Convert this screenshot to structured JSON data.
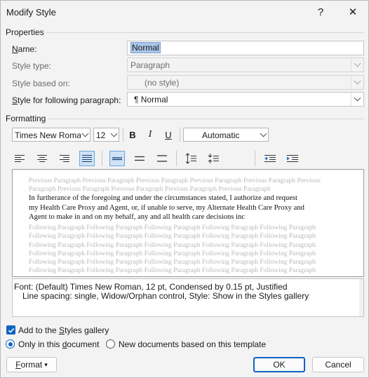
{
  "window": {
    "title": "Modify Style",
    "help_icon": "?",
    "close_icon": "✕"
  },
  "properties": {
    "section_title": "Properties",
    "name": {
      "label_ul": "N",
      "label_rest": "ame:",
      "value": "Normal"
    },
    "style_type": {
      "label": "Style type:",
      "value": "Paragraph"
    },
    "style_based_on": {
      "label": "Style based on:",
      "value": "(no style)"
    },
    "following": {
      "label_ul": "S",
      "label_rest": "tyle for following paragraph:",
      "value": "¶  Normal"
    }
  },
  "formatting": {
    "section_title": "Formatting",
    "font": "Times New Roman",
    "size": "12",
    "bold": "B",
    "italic": "I",
    "underline": "U",
    "color": "Automatic"
  },
  "preview": {
    "prev_lines": [
      "Previous Paragraph Previous Paragraph Previous Paragraph Previous Paragraph Previous Paragraph Previous",
      "Paragraph Previous Paragraph Previous Paragraph Previous Paragraph Previous Paragraph"
    ],
    "main_lines": [
      "In furtherance of the foregoing and under the circumstances stated, I authorize and request",
      "my Health Care Proxy and Agent, or, if unable to serve, my Alternate Health Care Proxy and",
      "Agent to make in and on my behalf, any and all health care decisions inc"
    ],
    "follow_lines": [
      "Following Paragraph Following Paragraph Following Paragraph Following Paragraph Following Paragraph",
      "Following Paragraph Following Paragraph Following Paragraph Following Paragraph Following Paragraph",
      "Following Paragraph Following Paragraph Following Paragraph Following Paragraph Following Paragraph",
      "Following Paragraph Following Paragraph Following Paragraph Following Paragraph Following Paragraph",
      "Following Paragraph Following Paragraph Following Paragraph Following Paragraph Following Paragraph",
      "Following Paragraph Following Paragraph Following Paragraph Following Paragraph Following Paragraph"
    ]
  },
  "description": {
    "line1": "Font: (Default) Times New Roman, 12 pt, Condensed by  0.15 pt, Justified",
    "line2": "Line spacing:  single, Widow/Orphan control, Style: Show in the Styles gallery"
  },
  "options": {
    "add_gallery": {
      "pre": "Add to the ",
      "ul": "S",
      "post": "tyles gallery",
      "checked": true
    },
    "only_doc": {
      "pre": "Only in this ",
      "ul": "d",
      "post": "ocument",
      "selected": true
    },
    "new_docs": {
      "label": "New documents based on this template",
      "selected": false
    }
  },
  "buttons": {
    "format_ul": "F",
    "format_rest": "ormat",
    "format_arrow": "▾",
    "ok": "OK",
    "cancel": "Cancel"
  },
  "colors": {
    "accent": "#1064c0",
    "selection": "#a9c6ea",
    "active_button": "#cfe2f7"
  }
}
